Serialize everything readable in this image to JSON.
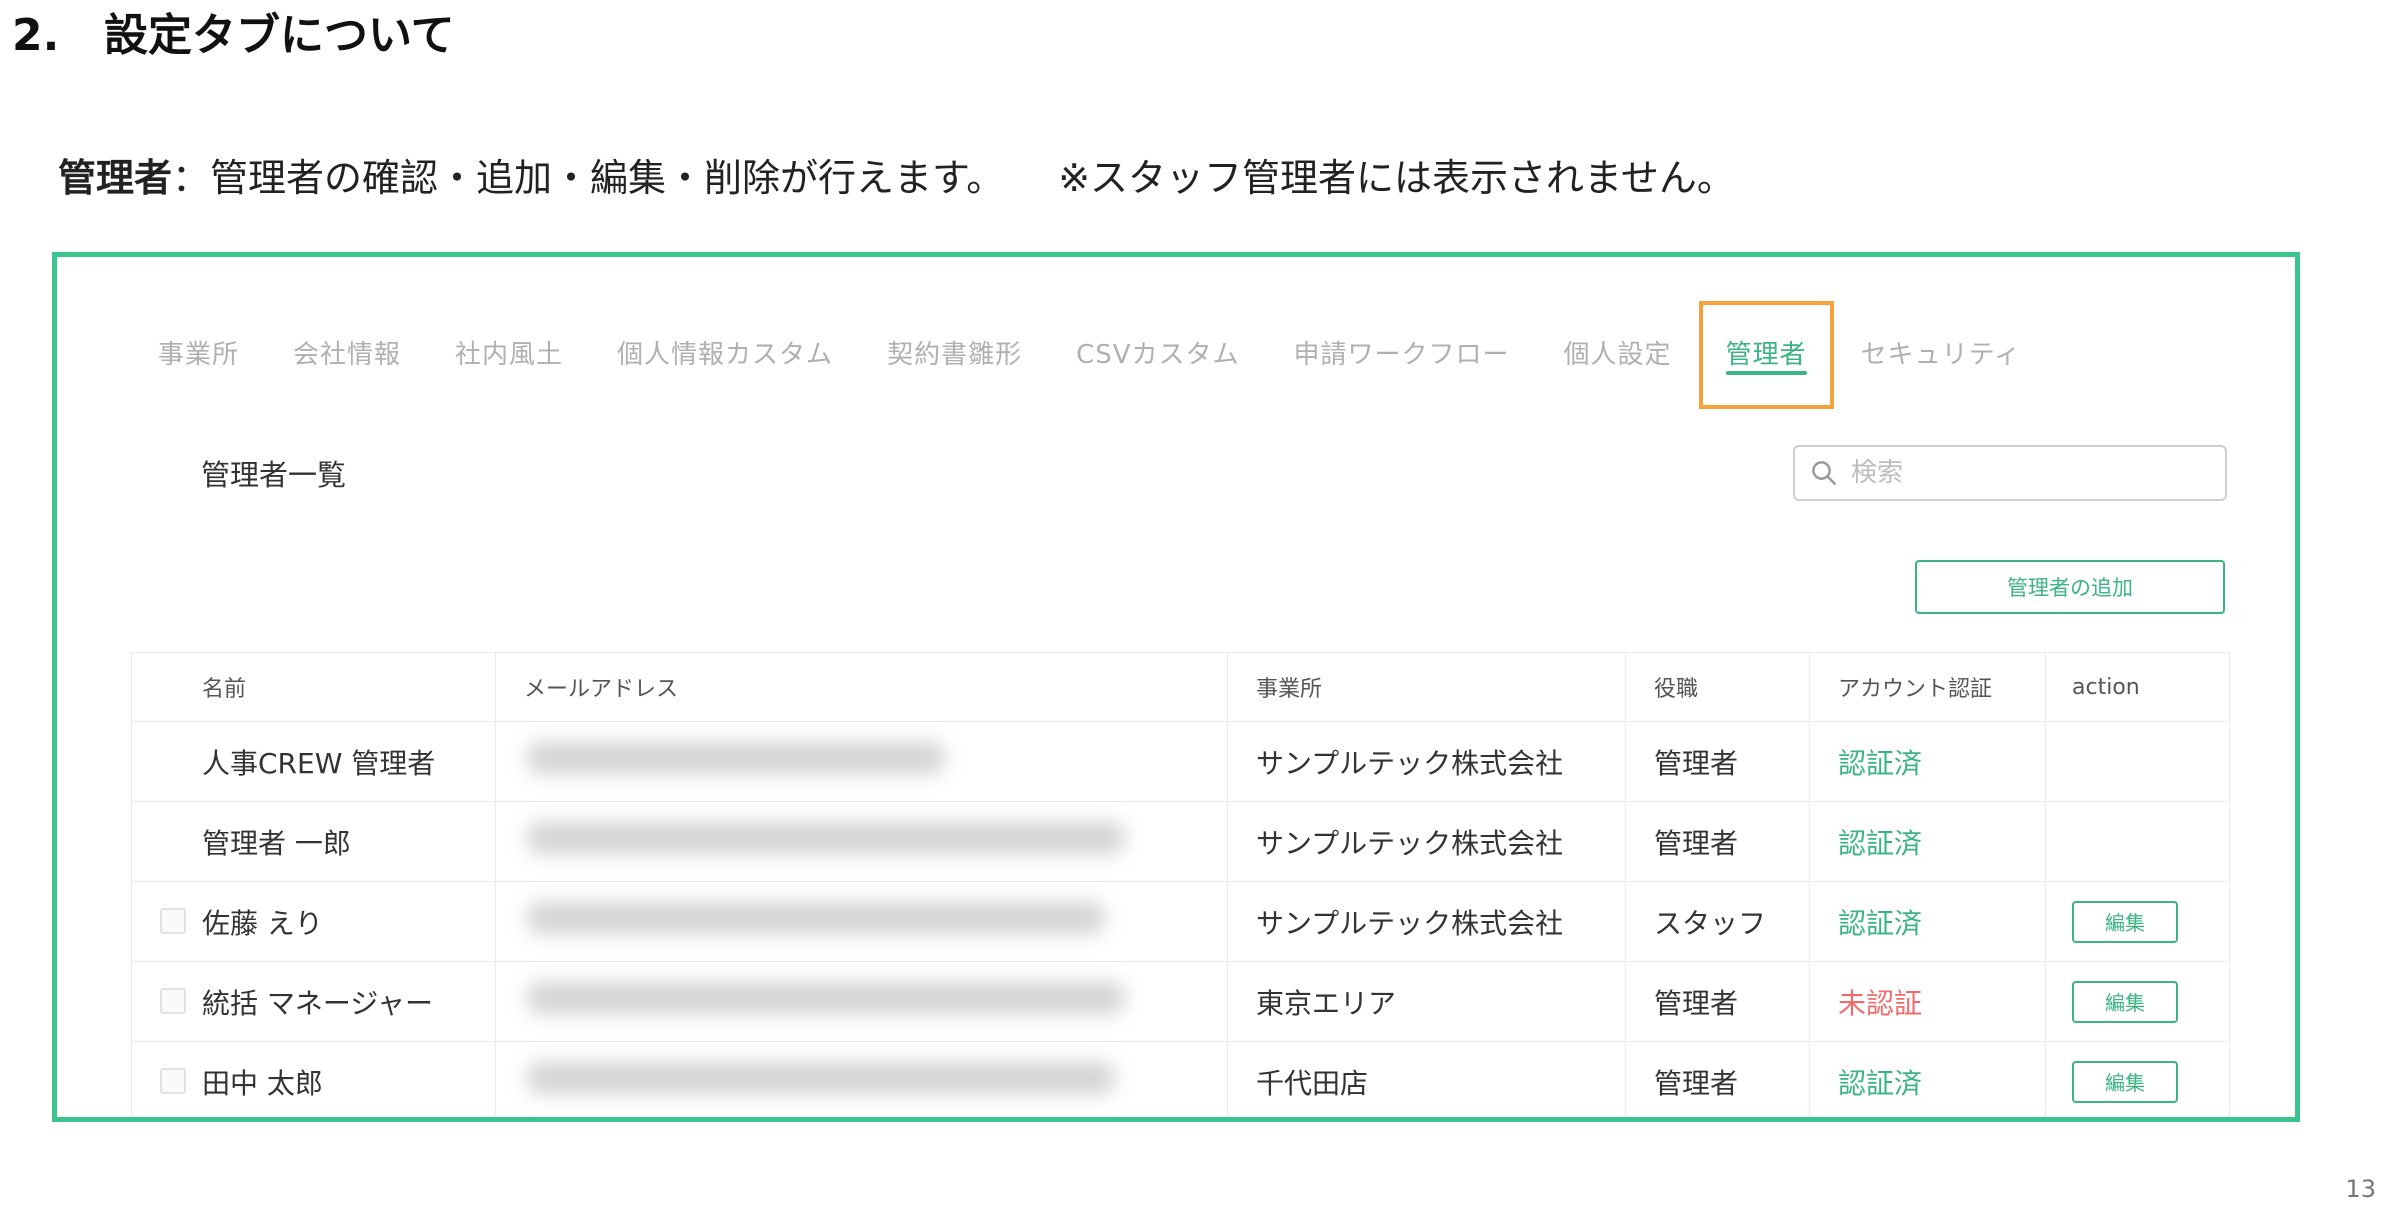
{
  "heading": {
    "number": "2.",
    "title": "設定タブについて"
  },
  "description": {
    "bold": "管理者",
    "text": "：管理者の確認・追加・編集・削除が行えます。",
    "note": "※スタッフ管理者には表示されません。"
  },
  "tabs": [
    {
      "label": "事業所"
    },
    {
      "label": "会社情報"
    },
    {
      "label": "社内風土"
    },
    {
      "label": "個人情報カスタム"
    },
    {
      "label": "契約書雛形"
    },
    {
      "label": "CSVカスタム"
    },
    {
      "label": "申請ワークフロー"
    },
    {
      "label": "個人設定"
    },
    {
      "label": "管理者",
      "active": true
    },
    {
      "label": "セキュリティ"
    }
  ],
  "list_title": "管理者一覧",
  "search": {
    "placeholder": "検索",
    "icon": "search-icon"
  },
  "add_button": "管理者の追加",
  "table": {
    "columns": [
      "名前",
      "メールアドレス",
      "事業所",
      "役職",
      "アカウント認証",
      "action"
    ],
    "rows": [
      {
        "name": "人事CREW 管理者",
        "office": "サンプルテック株式会社",
        "role": "管理者",
        "status": "認証済",
        "verified": true,
        "checkbox": false,
        "edit": ""
      },
      {
        "name": "管理者 一郎",
        "office": "サンプルテック株式会社",
        "role": "管理者",
        "status": "認証済",
        "verified": true,
        "checkbox": false,
        "edit": ""
      },
      {
        "name": "佐藤 えり",
        "office": "サンプルテック株式会社",
        "role": "スタッフ",
        "status": "認証済",
        "verified": true,
        "checkbox": true,
        "edit": "編集"
      },
      {
        "name": "統括 マネージャー",
        "office": "東京エリア",
        "role": "管理者",
        "status": "未認証",
        "verified": false,
        "checkbox": true,
        "edit": "編集"
      },
      {
        "name": "田中 太郎",
        "office": "千代田店",
        "role": "管理者",
        "status": "認証済",
        "verified": true,
        "checkbox": true,
        "edit": "編集"
      }
    ]
  },
  "colors": {
    "frame": "#3cc48f",
    "accent": "#3ab483",
    "highlight": "#f3a23c",
    "unverified": "#ef6b6b"
  },
  "page_number": "13"
}
